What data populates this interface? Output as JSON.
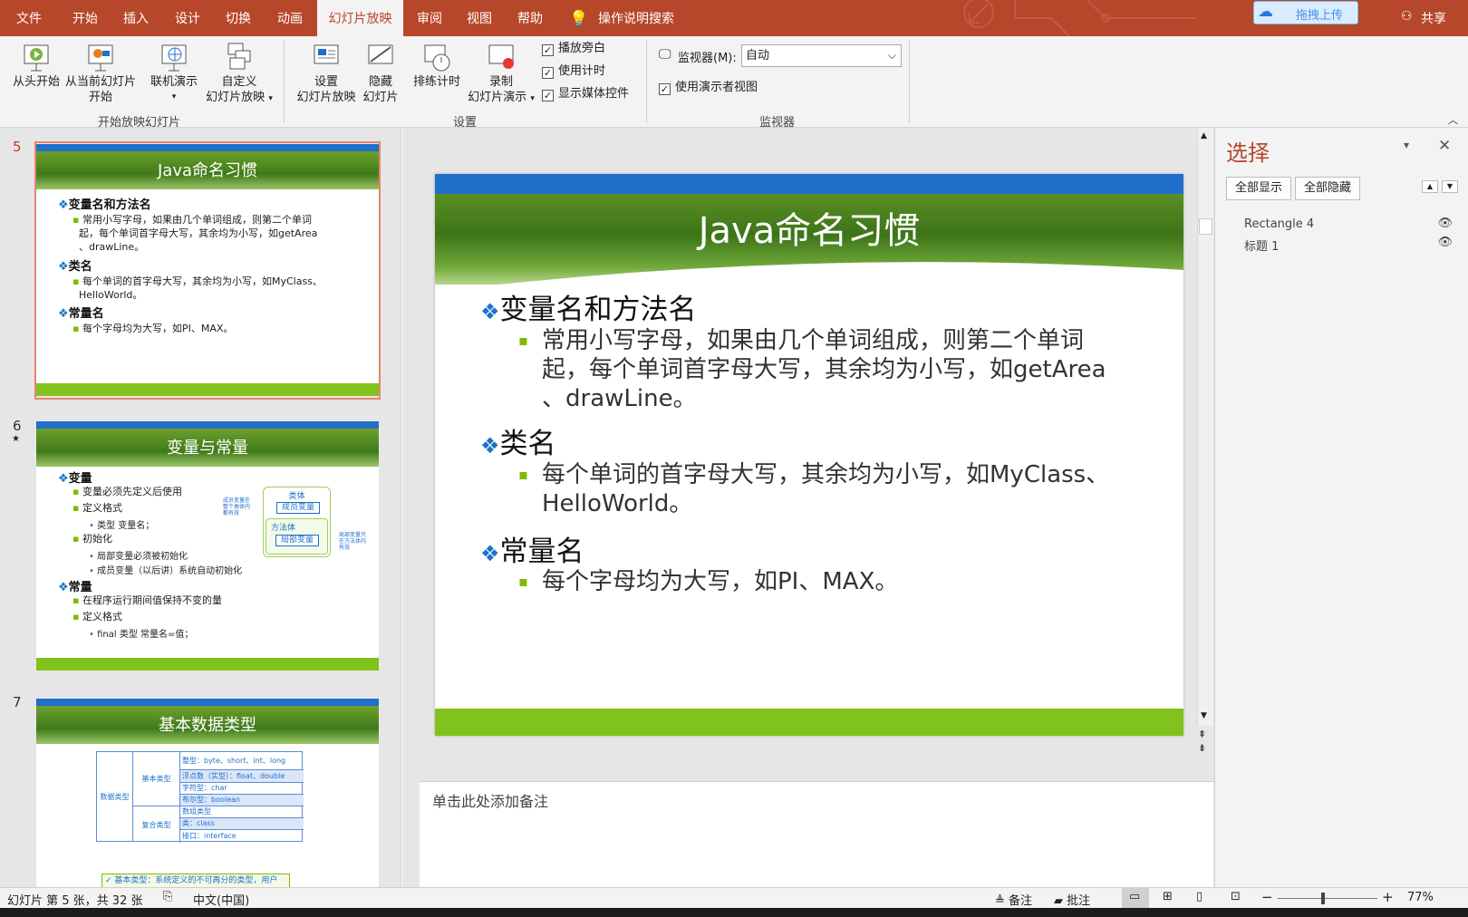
{
  "tabs": [
    "文件",
    "开始",
    "插入",
    "设计",
    "切换",
    "动画",
    "幻灯片放映",
    "审阅",
    "视图",
    "帮助"
  ],
  "search": "操作说明搜索",
  "upload": "拖拽上传",
  "share": "共享",
  "ribbon": {
    "from_start": "从头开始",
    "from_current_1": "从当前幻灯片",
    "from_current_2": "开始",
    "online_1": "联机演示",
    "custom_1": "自定义",
    "custom_2": "幻灯片放映",
    "group_start": "开始放映幻灯片",
    "setup_1": "设置",
    "setup_2": "幻灯片放映",
    "hide_1": "隐藏",
    "hide_2": "幻灯片",
    "rehearse": "排练计时",
    "record_1": "录制",
    "record_2": "幻灯片演示",
    "chk_narration": "播放旁白",
    "chk_timing": "使用计时",
    "chk_media": "显示媒体控件",
    "group_setup": "设置",
    "monitor_label": "监视器(M):",
    "monitor_value": "自动",
    "chk_presenter": "使用演示者视图",
    "group_monitor": "监视器"
  },
  "thumbs": {
    "n5": "5",
    "n6": "6",
    "n7": "7",
    "t5": {
      "title": "Java命名习惯",
      "h1": "变量名和方法名",
      "b1a": "常用小写字母，如果由几个单词组成，则第二个单词",
      "b1b": "起，每个单词首字母大写，其余均为小写，如getArea",
      "b1c": "、drawLine。",
      "h2": "类名",
      "b2a": "每个单词的首字母大写，其余均为小写，如MyClass、",
      "b2b": "HelloWorld。",
      "h3": "常量名",
      "b3": "每个字母均为大写，如PI、MAX。"
    },
    "t6": {
      "title": "变量与常量",
      "h1": "变量",
      "b1": "变量必须先定义后使用",
      "b2": "定义格式",
      "b2s": "类型 变量名；",
      "b3": "初始化",
      "b3s1": "局部变量必须被初始化",
      "b3s2": "成员变量（以后讲）系统自动初始化",
      "h2": "常量",
      "b4": "在程序运行期间值保持不变的量",
      "b5": "定义格式",
      "b5s": "final 类型 常量名=值；",
      "d_class": "类体",
      "d_member": "成员变量",
      "d_method": "方法体",
      "d_local": "局部变量",
      "d_note1a": "成员变量在",
      "d_note1b": "整个类体内",
      "d_note1c": "都有效",
      "d_note2a": "局部变量只",
      "d_note2b": "在方法体内",
      "d_note2c": "有效"
    },
    "t7": {
      "title": "基本数据类型",
      "root": "数据类型",
      "basic": "基本类型",
      "composite": "复合类型",
      "r1": "整型：byte、short、int、long",
      "r2": "浮点数（实型）：float、double",
      "r3": "字符型：char",
      "r4": "布尔型：boolean",
      "r5": "数组类型",
      "r6": "类：class",
      "r7": "接口：interface",
      "note": "✓ 基本类型：系统定义的不可再分的类型，用户"
    }
  },
  "slide": {
    "title": "Java命名习惯",
    "h1": "变量名和方法名",
    "b1_l1": "常用小写字母，如果由几个单词组成，则第二个单词",
    "b1_l2": "起，每个单词首字母大写，其余均为小写，如getArea",
    "b1_l3": "、drawLine。",
    "h2": "类名",
    "b2_l1": "每个单词的首字母大写，其余均为小写，如MyClass、",
    "b2_l2": "HelloWorld。",
    "h3": "常量名",
    "b3_l1": "每个字母均为大写，如PI、MAX。"
  },
  "notes_placeholder": "单击此处添加备注",
  "pane": {
    "title": "选择",
    "show_all": "全部显示",
    "hide_all": "全部隐藏",
    "item1": "Rectangle 4",
    "item2": "标题 1"
  },
  "status": {
    "slide_info": "幻灯片 第 5 张，共 32 张",
    "lang": "中文(中国)",
    "notes": "备注",
    "comments": "批注",
    "zoom": "77%"
  },
  "colors": {
    "accent": "#b7472a",
    "slide_bar": "#1f6fcb",
    "slide_green": "#7fc31c",
    "bullet_diamond": "#1a73c9",
    "bullet_square": "#7fba00"
  }
}
